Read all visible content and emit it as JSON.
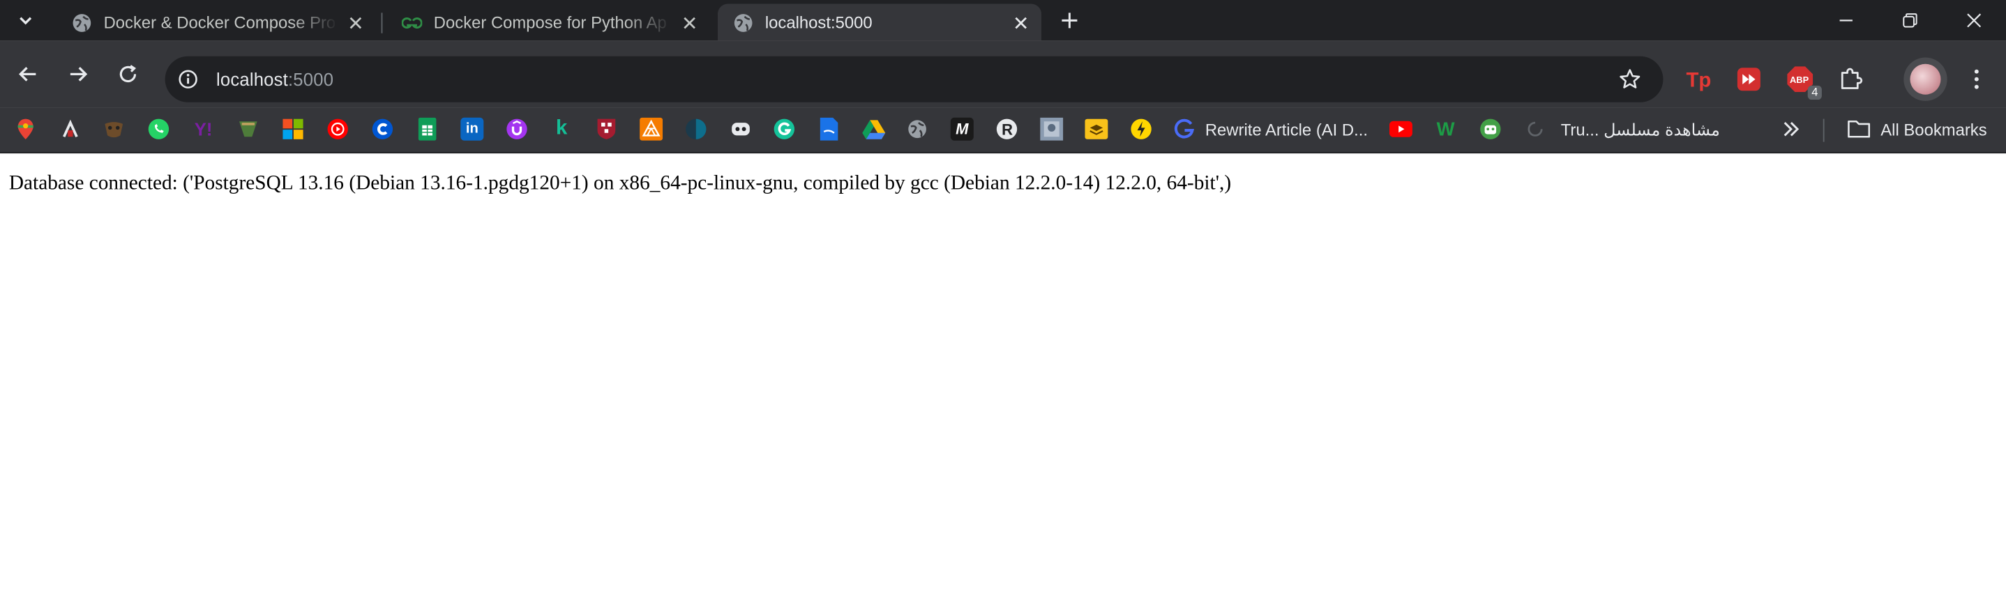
{
  "tabs": [
    {
      "title": "Docker & Docker Compose Pro",
      "favicon": "globe-icon",
      "active": false
    },
    {
      "title": "Docker Compose for Python Ap",
      "favicon": "geeksforgeeks-icon",
      "active": false
    },
    {
      "title": "localhost:5000",
      "favicon": "globe-icon",
      "active": true
    }
  ],
  "toolbar": {
    "url_host": "localhost",
    "url_port": ":5000",
    "extensions": [
      "tp-icon",
      "video-speed-icon",
      "adblock-icon",
      "puzzle-icon"
    ],
    "adblock_badge": "4"
  },
  "bookmarks": {
    "icons": [
      "maps-icon",
      "app-icon",
      "mask-icon",
      "whatsapp-icon",
      "yahoo-icon",
      "game-icon",
      "microsoft-icon",
      "youtube-music-icon",
      "coursera-icon",
      "sheets-icon",
      "linkedin-icon",
      "udemy-icon",
      "khan-icon",
      "harvard-icon",
      "triangles-icon",
      "dark-circle-icon",
      "bot-icon",
      "grammarly-icon",
      "docs-icon",
      "drive-icon",
      "globe-icon",
      "medium-icon",
      "r-icon",
      "image-icon",
      "stack-icon",
      "bulb-icon"
    ],
    "rewrite_label": "Rewrite Article (AI D...",
    "arabic_label": "Tru... مشاهدة مسلسل",
    "all_bookmarks": "All Bookmarks"
  },
  "page": {
    "text": "Database connected: ('PostgreSQL 13.16 (Debian 13.16-1.pgdg120+1) on x86_64-pc-linux-gnu, compiled by gcc (Debian 12.2.0-14) 12.2.0, 64-bit',)"
  },
  "colors": {
    "tabstrip": "#202124",
    "toolbar": "#35363a",
    "omnibox": "#202124",
    "page": "#ffffff"
  }
}
